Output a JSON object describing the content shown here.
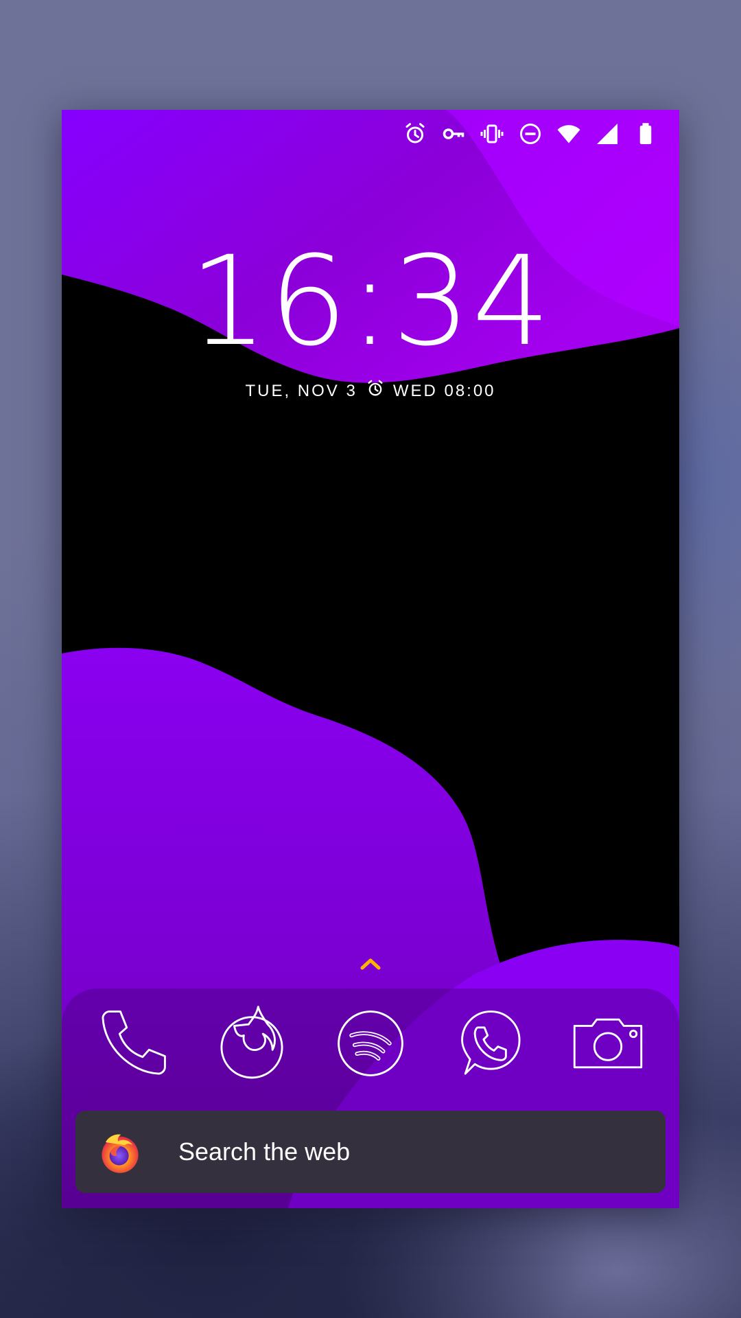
{
  "lockscreen": {
    "time": "16:34",
    "date": "TUE, NOV 3",
    "next_alarm": "WED 08:00"
  },
  "status_bar": {
    "icons": [
      "alarm-icon",
      "vpn-key-icon",
      "vibrate-icon",
      "do-not-disturb-icon",
      "wifi-icon",
      "cellular-signal-icon",
      "battery-icon"
    ]
  },
  "dock": {
    "apps": [
      {
        "name": "phone-icon"
      },
      {
        "name": "firefox-icon"
      },
      {
        "name": "spotify-icon"
      },
      {
        "name": "whatsapp-icon"
      },
      {
        "name": "camera-icon"
      }
    ]
  },
  "search": {
    "placeholder": "Search the web",
    "logo": "firefox-logo"
  },
  "colors": {
    "accent_purple": "#8b00f2",
    "deep_purple": "#6a00b8",
    "swipe_arrow": "#ffb300"
  }
}
